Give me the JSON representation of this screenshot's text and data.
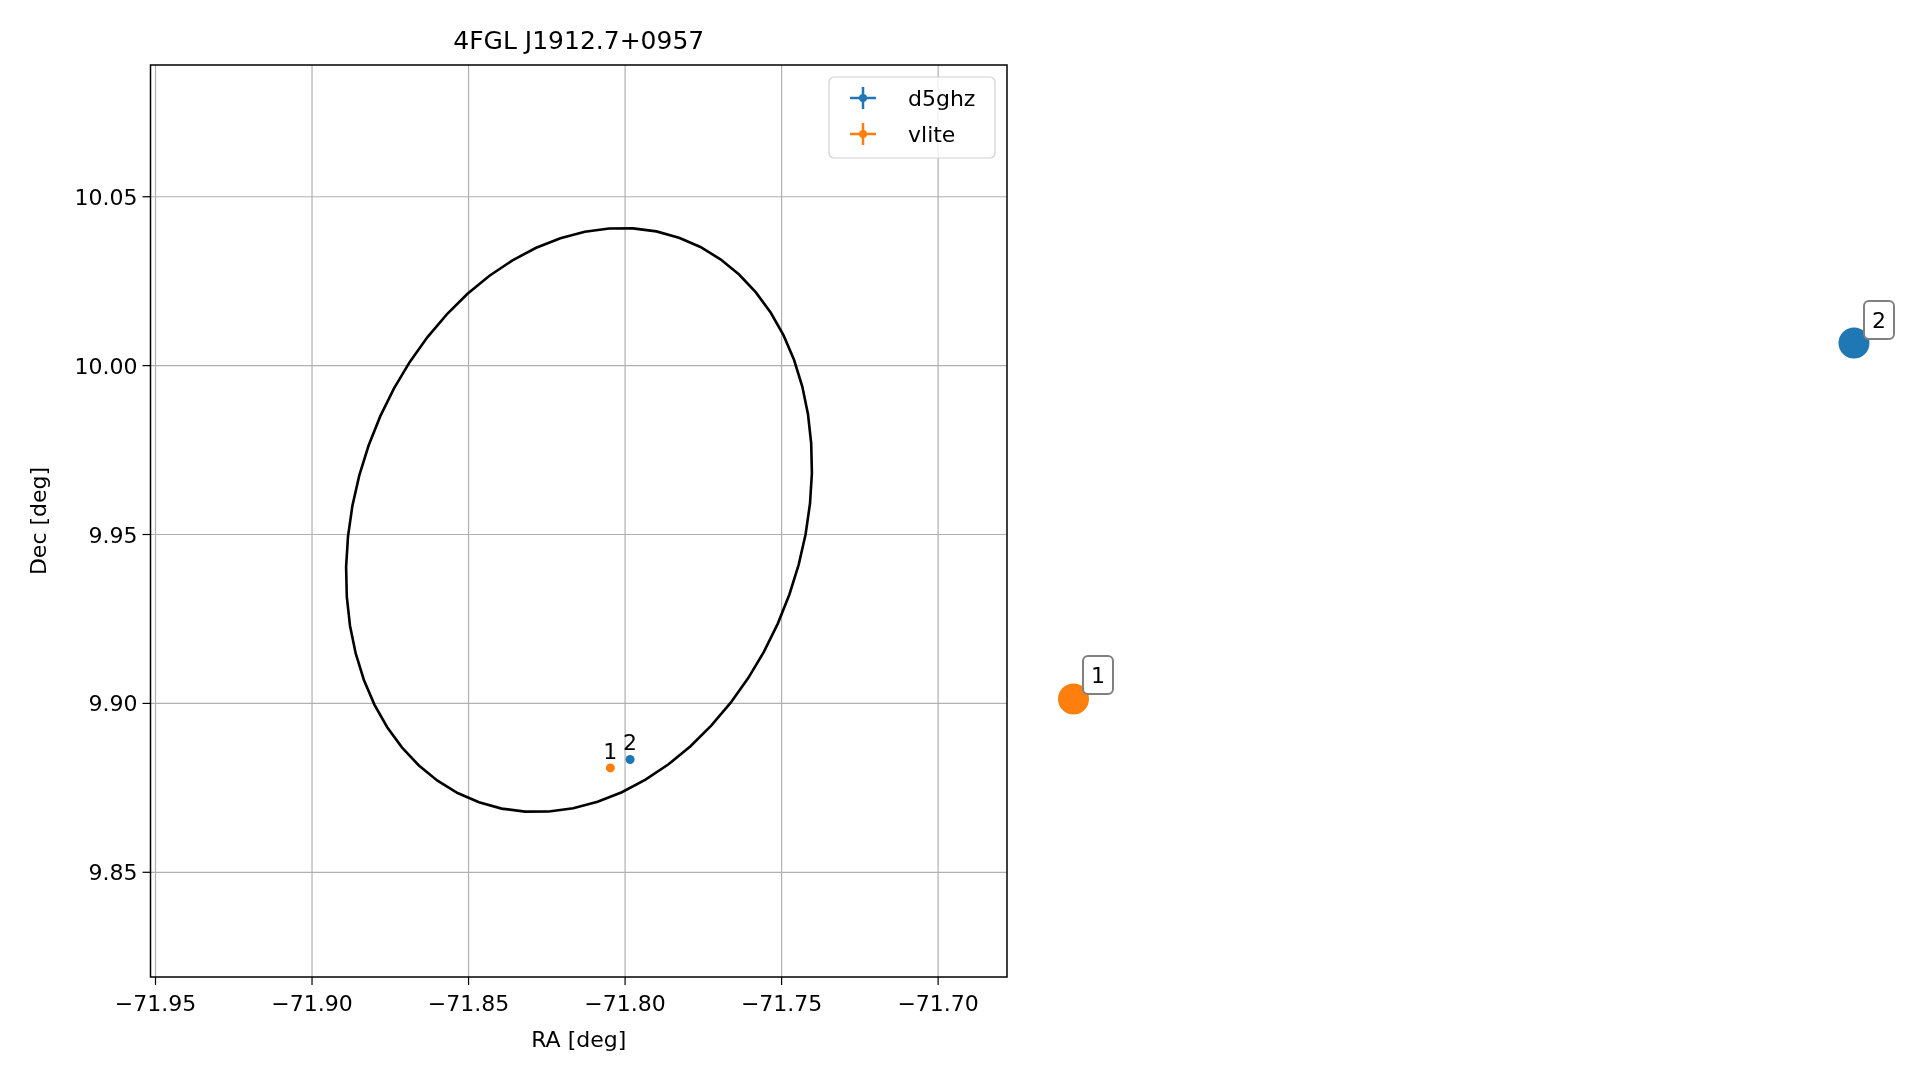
{
  "figure": {
    "chart_data": {
      "type": "scatter",
      "title": "4FGL J1912.7+0957",
      "xlabel": "RA [deg]",
      "ylabel": "Dec [deg]",
      "xlim": [
        -71.9516,
        -71.678
      ],
      "ylim": [
        9.819,
        10.089
      ],
      "grid": true,
      "legend": true,
      "xticks": [
        {
          "value": -71.95,
          "label": "−71.95"
        },
        {
          "value": -71.9,
          "label": "−71.90"
        },
        {
          "value": -71.85,
          "label": "−71.85"
        },
        {
          "value": -71.8,
          "label": "−71.80"
        },
        {
          "value": -71.75,
          "label": "−71.75"
        },
        {
          "value": -71.7,
          "label": "−71.70"
        }
      ],
      "yticks": [
        {
          "value": 9.85,
          "label": "9.85"
        },
        {
          "value": 9.9,
          "label": "9.90"
        },
        {
          "value": 9.95,
          "label": "9.95"
        },
        {
          "value": 10.0,
          "label": "10.00"
        },
        {
          "value": 10.05,
          "label": "10.05"
        }
      ],
      "series": [
        {
          "name": "d5ghz",
          "color": "#1f77b4",
          "x": [
            -71.7984
          ],
          "values": [
            9.8834
          ]
        },
        {
          "name": "vlite",
          "color": "#ff7f0e",
          "x": [
            -71.8047
          ],
          "values": [
            9.8809
          ]
        }
      ],
      "annotations": [
        {
          "text": "2",
          "x": -71.7984,
          "y": 9.8834
        },
        {
          "text": "1",
          "x": -71.8047,
          "y": 9.8809
        }
      ]
    }
  },
  "callouts": [
    {
      "label": "1",
      "color": "#ff7f0e"
    },
    {
      "label": "2",
      "color": "#1f77b4"
    }
  ]
}
